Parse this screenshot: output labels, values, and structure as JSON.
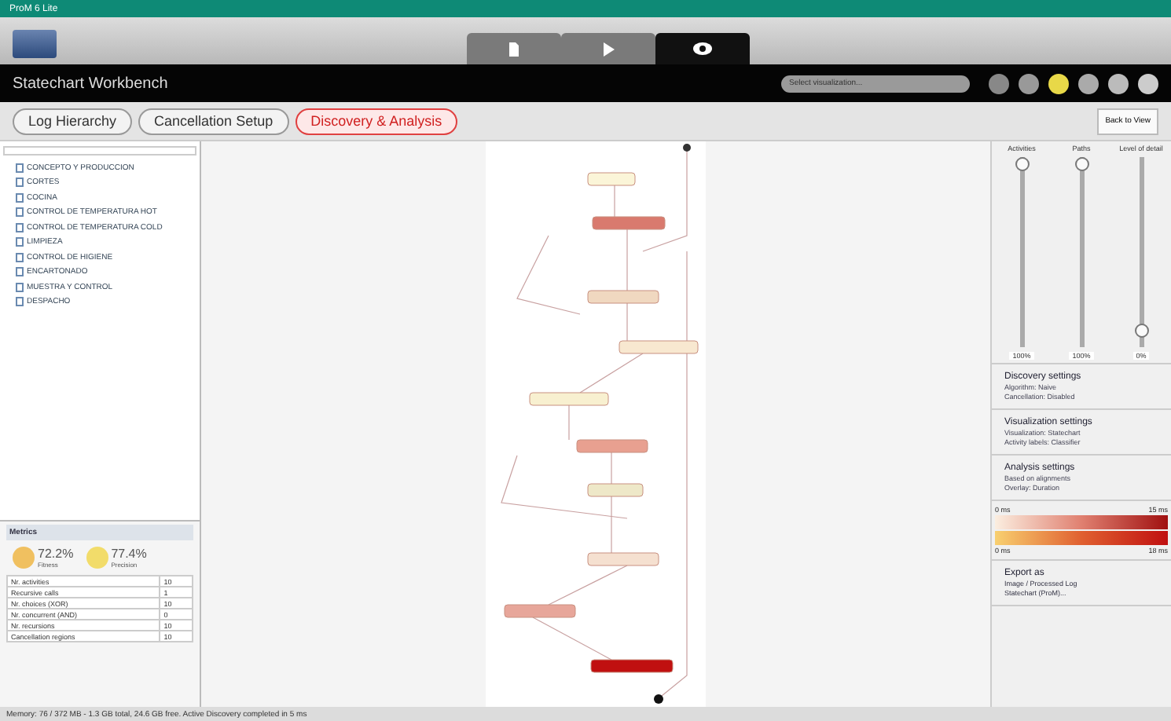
{
  "window": {
    "title": "ProM 6 Lite"
  },
  "mode_tabs": [
    {
      "kind": "import",
      "selected": false
    },
    {
      "kind": "play",
      "selected": false
    },
    {
      "kind": "view",
      "selected": true
    }
  ],
  "header": {
    "title": "Statechart Workbench",
    "search": {
      "placeholder": "Select visualization..."
    }
  },
  "breadcrumbs": [
    {
      "label": "Log Hierarchy",
      "selected": false
    },
    {
      "label": "Cancellation Setup",
      "selected": false
    },
    {
      "label": "Discovery & Analysis",
      "selected": true
    }
  ],
  "tree": {
    "items": [
      {
        "label": "CONCEPTO Y PRODUCCION"
      },
      {
        "label": "CORTES"
      },
      {
        "label": "COCINA"
      },
      {
        "label": "CONTROL DE TEMPERATURA HOT"
      },
      {
        "label": "CONTROL DE TEMPERATURA COLD"
      },
      {
        "label": "LIMPIEZA"
      },
      {
        "label": "CONTROL DE HIGIENE"
      },
      {
        "label": "ENCARTONADO"
      },
      {
        "label": "MUESTRA Y CONTROL"
      },
      {
        "label": "DESPACHO"
      }
    ]
  },
  "metrics": {
    "title": "Metrics",
    "gauges": [
      {
        "value": "72.2%",
        "label": "Fitness",
        "color": "#f0c060"
      },
      {
        "value": "77.4%",
        "label": "Precision",
        "color": "#f2dc6a"
      }
    ],
    "rows": [
      {
        "name": "Nr. activities",
        "value": "10"
      },
      {
        "name": "Recursive calls",
        "value": "1"
      },
      {
        "name": "Nr. choices (XOR)",
        "value": "10"
      },
      {
        "name": "Nr. concurrent (AND)",
        "value": "0"
      },
      {
        "name": "Nr. recursions",
        "value": "10"
      },
      {
        "name": "Cancellation regions",
        "value": "10"
      }
    ]
  },
  "sliders": [
    {
      "label": "Activities",
      "level": 1,
      "reading": "100%"
    },
    {
      "label": "Paths",
      "level": 1,
      "reading": "100%"
    },
    {
      "label": "Level of detail",
      "level": 0.05,
      "reading": "0%"
    }
  ],
  "settings": [
    {
      "title": "Discovery settings",
      "lines": [
        "Algorithm: Naive",
        "Cancellation: Disabled"
      ]
    },
    {
      "title": "Visualization settings",
      "lines": [
        "Visualization: Statechart",
        "Activity labels: Classifier"
      ]
    },
    {
      "title": "Analysis settings",
      "lines": [
        "Based on alignments",
        "Overlay: Duration"
      ]
    }
  ],
  "legend": {
    "top_min": "0 ms",
    "top_max": "15 ms",
    "bottom_min": "0 ms",
    "bottom_max": "18 ms"
  },
  "export": {
    "title": "Export as",
    "links": [
      "Image / Processed Log",
      "Statechart (ProM)..."
    ]
  },
  "view_button": "Back to View",
  "status": "Memory: 76 / 372 MB - 1.3 GB total, 24.6 GB free. Active Discovery completed in 5 ms"
}
